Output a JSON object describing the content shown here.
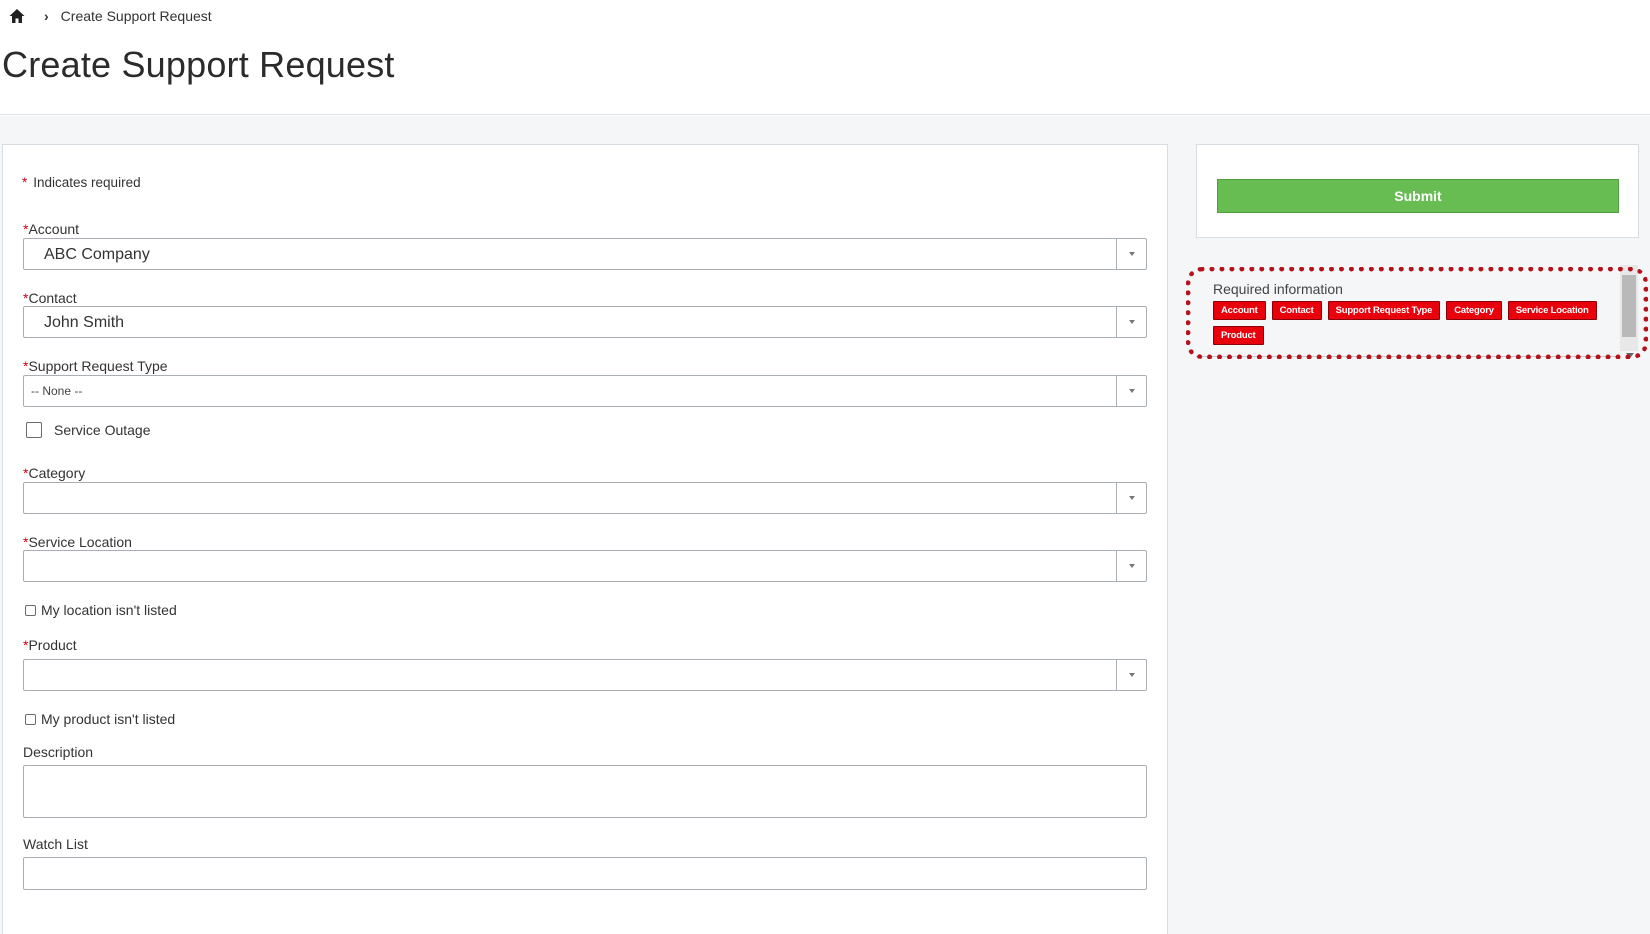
{
  "breadcrumb": {
    "home_icon": "home-icon",
    "current": "Create Support Request"
  },
  "page": {
    "title": "Create Support Request"
  },
  "form": {
    "required_note": "Indicates required",
    "account": {
      "label": "Account",
      "value": "ABC Company"
    },
    "contact": {
      "label": "Contact",
      "value": "John Smith"
    },
    "support_request_type": {
      "label": "Support Request Type",
      "value": "-- None --"
    },
    "service_outage": {
      "label": "Service Outage",
      "checked": false
    },
    "category": {
      "label": "Category",
      "value": ""
    },
    "service_location": {
      "label": "Service Location",
      "value": ""
    },
    "location_not_listed": {
      "label": "My location isn't listed",
      "checked": false
    },
    "product": {
      "label": "Product",
      "value": ""
    },
    "product_not_listed": {
      "label": "My product isn't listed",
      "checked": false
    },
    "description": {
      "label": "Description",
      "value": ""
    },
    "watch_list": {
      "label": "Watch List",
      "value": ""
    }
  },
  "sidebar": {
    "submit_label": "Submit",
    "required_info_title": "Required information",
    "required_tags": [
      "Account",
      "Contact",
      "Support Request Type",
      "Category",
      "Service Location",
      "Product"
    ]
  },
  "colors": {
    "submit_green": "#67bd52",
    "required_tag_red": "#e8000d",
    "highlight_red": "#b5121b",
    "required_star": "#d0021b"
  }
}
